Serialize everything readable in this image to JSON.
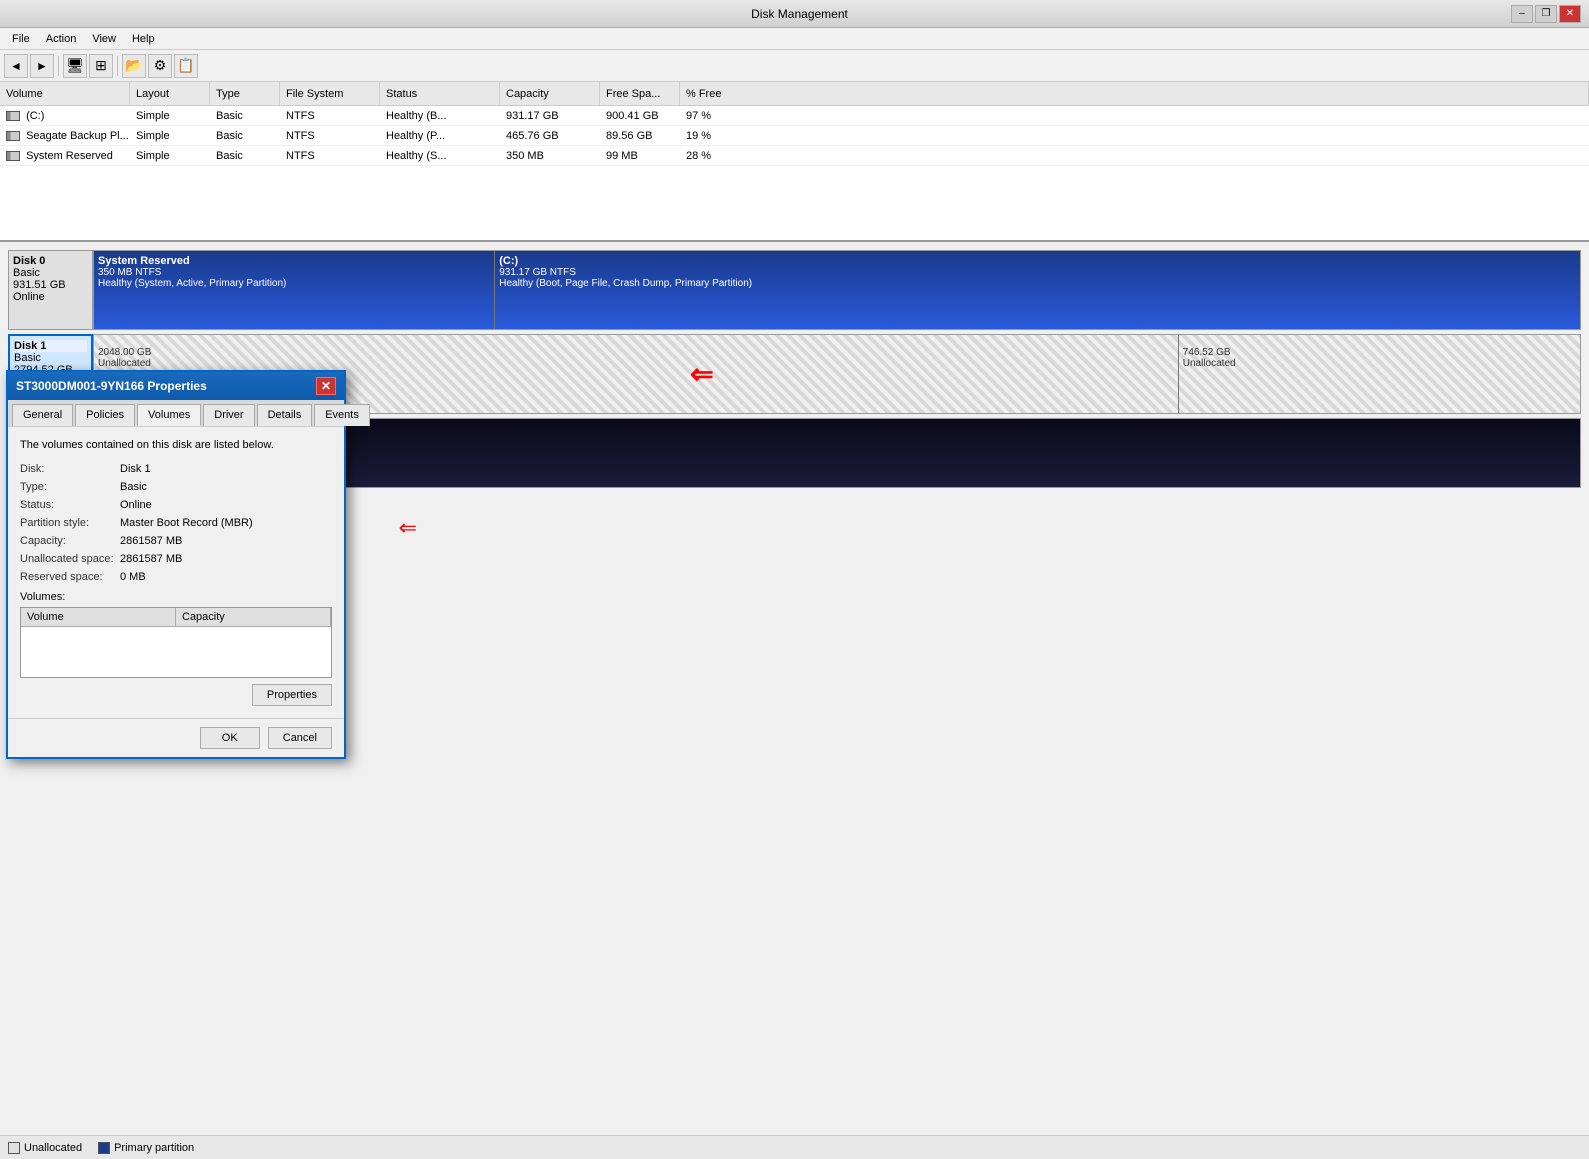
{
  "window": {
    "title": "Disk Management",
    "min_label": "–",
    "restore_label": "❐",
    "close_label": "✕"
  },
  "menu": {
    "items": [
      "File",
      "Action",
      "View",
      "Help"
    ]
  },
  "toolbar": {
    "buttons": [
      "◄",
      "►",
      "▲",
      "▼"
    ]
  },
  "list": {
    "headers": [
      "Volume",
      "Layout",
      "Type",
      "File System",
      "Status",
      "Capacity",
      "Free Spa...",
      "% Free"
    ],
    "rows": [
      {
        "volume": "(C:)",
        "layout": "Simple",
        "type": "Basic",
        "filesystem": "NTFS",
        "status": "Healthy (B...",
        "capacity": "931.17 GB",
        "free": "900.41 GB",
        "percent": "97 %"
      },
      {
        "volume": "Seagate Backup Pl...",
        "layout": "Simple",
        "type": "Basic",
        "filesystem": "NTFS",
        "status": "Healthy (P...",
        "capacity": "465.76 GB",
        "free": "89.56 GB",
        "percent": "19 %"
      },
      {
        "volume": "System Reserved",
        "layout": "Simple",
        "type": "Basic",
        "filesystem": "NTFS",
        "status": "Healthy (S...",
        "capacity": "350 MB",
        "free": "99 MB",
        "percent": "28 %"
      }
    ]
  },
  "disk0": {
    "name": "Disk 0",
    "type": "Basic",
    "size": "931.51 GB",
    "status": "Online",
    "system_partition": {
      "name": "System Reserved",
      "size": "350 MB NTFS",
      "status": "Healthy (System, Active, Primary Partition)"
    },
    "c_partition": {
      "name": "(C:)",
      "size": "931.17 GB NTFS",
      "status": "Healthy (Boot, Page File, Crash Dump, Primary Partition)"
    }
  },
  "disk1": {
    "name": "Disk 1",
    "type": "Basic",
    "size": "2794.52 GB",
    "status": "Online",
    "unalloc1": {
      "size": "2048.00 GB",
      "label": "Unallocated"
    },
    "unalloc2": {
      "size": "746.52 GB",
      "label": "Unallocated"
    }
  },
  "dialog": {
    "title": "ST3000DM001-9YN166 Properties",
    "tabs": [
      "General",
      "Policies",
      "Volumes",
      "Driver",
      "Details",
      "Events"
    ],
    "active_tab": "Volumes",
    "intro": "The volumes contained on this disk are listed below.",
    "fields": {
      "disk_label": "Disk:",
      "disk_value": "Disk 1",
      "type_label": "Type:",
      "type_value": "Basic",
      "status_label": "Status:",
      "status_value": "Online",
      "partition_style_label": "Partition style:",
      "partition_style_value": "Master Boot Record (MBR)",
      "capacity_label": "Capacity:",
      "capacity_value": "2861587 MB",
      "unallocated_label": "Unallocated space:",
      "unallocated_value": "2861587 MB",
      "reserved_label": "Reserved space:",
      "reserved_value": "0 MB"
    },
    "volumes_label": "Volumes:",
    "table_headers": [
      "Volume",
      "Capacity"
    ],
    "buttons": {
      "properties": "Properties",
      "ok": "OK",
      "cancel": "Cancel"
    }
  },
  "legend": {
    "items": [
      {
        "color": "#e8e8e8",
        "label": "Unallocated"
      },
      {
        "color": "#1a3a8c",
        "label": "Primary partition"
      }
    ]
  }
}
